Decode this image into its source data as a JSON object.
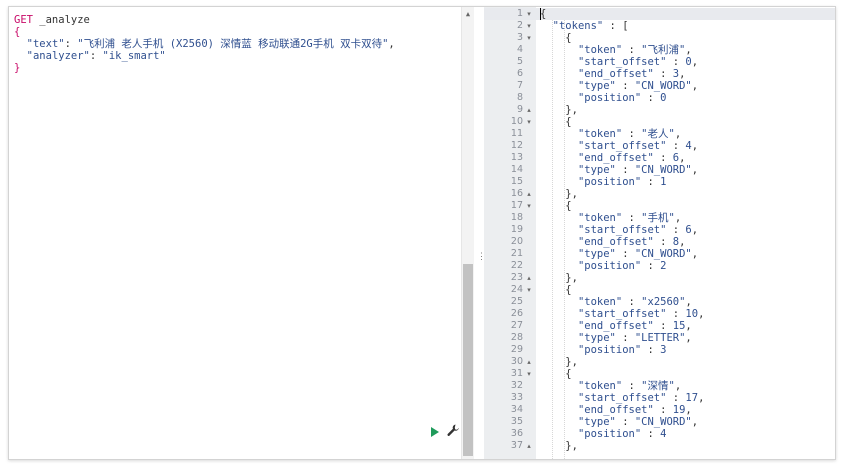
{
  "left_editor": {
    "lines": [
      {
        "kw": "GET",
        "rest": " _analyze"
      },
      {
        "text": "{"
      },
      {
        "key": "\"text\"",
        "sep": ": ",
        "val": "\"飞利浦 老人手机 (X2560) 深情蓝 移动联通2G手机 双卡双待\"",
        "end": ","
      },
      {
        "key": "\"analyzer\"",
        "sep": ": ",
        "val": "\"ik_smart\"",
        "end": ""
      },
      {
        "text": "}"
      }
    ]
  },
  "scrollbar": {
    "arrow": "▲"
  },
  "resize_handle": {
    "glyph": "⋮"
  },
  "output": {
    "lines": [
      {
        "n": "1",
        "fold": "▾",
        "text": "{"
      },
      {
        "n": "2",
        "fold": "▾",
        "key": "\"tokens\"",
        "after": " : ["
      },
      {
        "n": "3",
        "fold": "▾",
        "text": "    {"
      },
      {
        "n": "4",
        "fold": "",
        "key": "\"token\"",
        "val": "\"飞利浦\"",
        "end": ","
      },
      {
        "n": "5",
        "fold": "",
        "key": "\"start_offset\"",
        "val": "0",
        "end": ","
      },
      {
        "n": "6",
        "fold": "",
        "key": "\"end_offset\"",
        "val": "3",
        "end": ","
      },
      {
        "n": "7",
        "fold": "",
        "key": "\"type\"",
        "val": "\"CN_WORD\"",
        "end": ","
      },
      {
        "n": "8",
        "fold": "",
        "key": "\"position\"",
        "val": "0",
        "end": ""
      },
      {
        "n": "9",
        "fold": "▴",
        "text": "    },"
      },
      {
        "n": "10",
        "fold": "▾",
        "text": "    {"
      },
      {
        "n": "11",
        "fold": "",
        "key": "\"token\"",
        "val": "\"老人\"",
        "end": ","
      },
      {
        "n": "12",
        "fold": "",
        "key": "\"start_offset\"",
        "val": "4",
        "end": ","
      },
      {
        "n": "13",
        "fold": "",
        "key": "\"end_offset\"",
        "val": "6",
        "end": ","
      },
      {
        "n": "14",
        "fold": "",
        "key": "\"type\"",
        "val": "\"CN_WORD\"",
        "end": ","
      },
      {
        "n": "15",
        "fold": "",
        "key": "\"position\"",
        "val": "1",
        "end": ""
      },
      {
        "n": "16",
        "fold": "▴",
        "text": "    },"
      },
      {
        "n": "17",
        "fold": "▾",
        "text": "    {"
      },
      {
        "n": "18",
        "fold": "",
        "key": "\"token\"",
        "val": "\"手机\"",
        "end": ","
      },
      {
        "n": "19",
        "fold": "",
        "key": "\"start_offset\"",
        "val": "6",
        "end": ","
      },
      {
        "n": "20",
        "fold": "",
        "key": "\"end_offset\"",
        "val": "8",
        "end": ","
      },
      {
        "n": "21",
        "fold": "",
        "key": "\"type\"",
        "val": "\"CN_WORD\"",
        "end": ","
      },
      {
        "n": "22",
        "fold": "",
        "key": "\"position\"",
        "val": "2",
        "end": ""
      },
      {
        "n": "23",
        "fold": "▴",
        "text": "    },"
      },
      {
        "n": "24",
        "fold": "▾",
        "text": "    {"
      },
      {
        "n": "25",
        "fold": "",
        "key": "\"token\"",
        "val": "\"x2560\"",
        "end": ","
      },
      {
        "n": "26",
        "fold": "",
        "key": "\"start_offset\"",
        "val": "10",
        "end": ","
      },
      {
        "n": "27",
        "fold": "",
        "key": "\"end_offset\"",
        "val": "15",
        "end": ","
      },
      {
        "n": "28",
        "fold": "",
        "key": "\"type\"",
        "val": "\"LETTER\"",
        "end": ","
      },
      {
        "n": "29",
        "fold": "",
        "key": "\"position\"",
        "val": "3",
        "end": ""
      },
      {
        "n": "30",
        "fold": "▴",
        "text": "    },"
      },
      {
        "n": "31",
        "fold": "▾",
        "text": "    {"
      },
      {
        "n": "32",
        "fold": "",
        "key": "\"token\"",
        "val": "\"深情\"",
        "end": ","
      },
      {
        "n": "33",
        "fold": "",
        "key": "\"start_offset\"",
        "val": "17",
        "end": ","
      },
      {
        "n": "34",
        "fold": "",
        "key": "\"end_offset\"",
        "val": "19",
        "end": ","
      },
      {
        "n": "35",
        "fold": "",
        "key": "\"type\"",
        "val": "\"CN_WORD\"",
        "end": ","
      },
      {
        "n": "36",
        "fold": "",
        "key": "\"position\"",
        "val": "4",
        "end": ""
      },
      {
        "n": "37",
        "fold": "▴",
        "text": "    },"
      }
    ]
  }
}
